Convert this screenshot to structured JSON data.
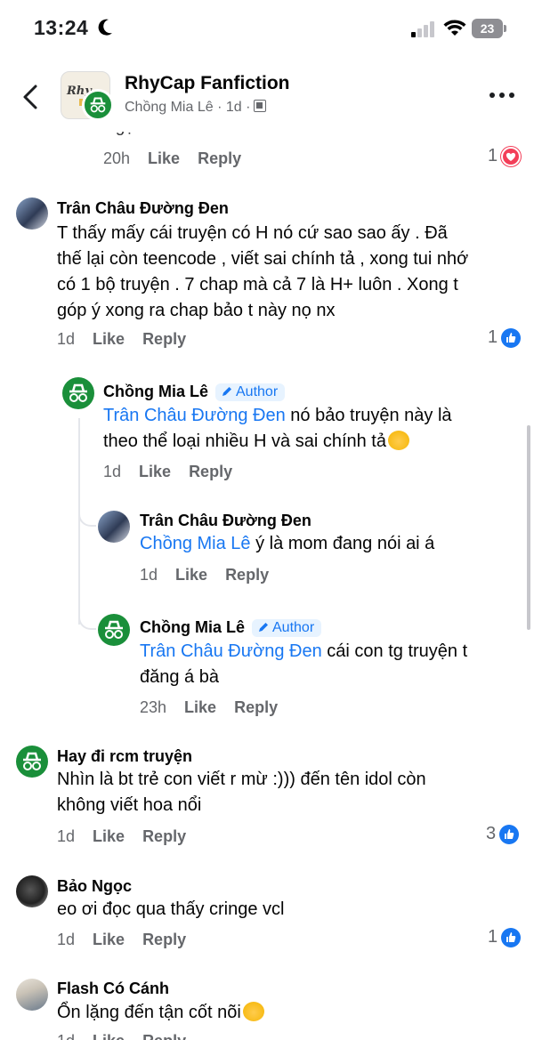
{
  "status": {
    "time": "13:24",
    "battery": "23"
  },
  "header": {
    "title": "RhyCap Fanfiction",
    "subtitle": "Chồng Mia Lê · 1d ·",
    "avatar_glyph": "Rhy"
  },
  "colors": {
    "accent": "#1877f2",
    "green": "#1a8f3a",
    "heart": "#f33e58",
    "meta": "#65676b"
  },
  "labels": {
    "like": "Like",
    "reply": "Reply",
    "author": "Author"
  },
  "top_comment": {
    "clipped_text": "Ngạn Thanh. Lướt đến cuối anh có ú b",
    "time": "20h",
    "reactions": "1",
    "reaction_type": "heart-icon"
  },
  "comments": [
    {
      "name": "Trân Châu Đường Đen",
      "lines": [
        "T thấy mấy cái truyện có H nó cứ sao sao ấy . Đã",
        "thế lại còn teencode , viết sai chính tả , xong tui nhớ",
        "có 1 bộ truyện . 7 chap mà cả 7 là H+ luôn . Xong t",
        "góp ý xong ra chap bảo t này nọ nx"
      ],
      "time": "1d",
      "reactions": "1",
      "replies": [
        {
          "name": "Chồng Mia Lê",
          "is_author": true,
          "mention": "Trân Châu Đường Đen",
          "line1": " nó bảo truyện này là",
          "line2": "theo thể loại nhiều H và sai chính tả",
          "emoji": "smiling-face-with-hearts-emoji",
          "time": "1d"
        },
        {
          "name": "Trân Châu Đường Đen",
          "is_author": false,
          "mention": "Chồng Mia Lê",
          "line1": " ý là mom đang nói ai á",
          "time": "1d"
        },
        {
          "name": "Chồng Mia Lê",
          "is_author": true,
          "mention": "Trân Châu Đường Đen",
          "line1": " cái con tg truyện t",
          "line2": "đăng á bà",
          "time": "23h"
        }
      ]
    },
    {
      "name": "Hay đi rcm truyện",
      "lines": [
        "Nhìn là bt trẻ con viết r mừ :))) đến tên idol còn",
        "không viết hoa nổi"
      ],
      "time": "1d",
      "reactions": "3"
    },
    {
      "name": "Bảo Ngọc",
      "lines": [
        "eo ơi đọc qua thấy cringe vcl"
      ],
      "time": "1d",
      "reactions": "1"
    },
    {
      "name": "Flash Có Cánh",
      "lines": [
        "Ổn lặng đến tận cốt nõi"
      ],
      "emoji": "loudly-crying-face-emoji",
      "time": "1d"
    }
  ]
}
